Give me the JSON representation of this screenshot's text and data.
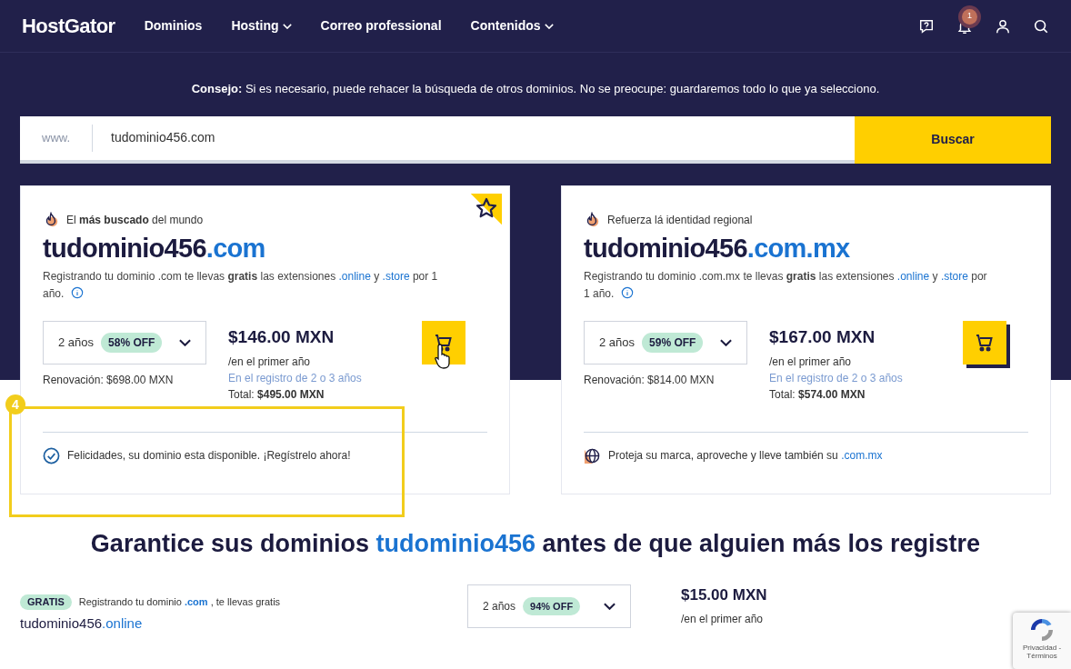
{
  "header": {
    "logo": "HostGator",
    "nav": [
      {
        "label": "Dominios",
        "has_menu": false
      },
      {
        "label": "Hosting",
        "has_menu": true
      },
      {
        "label": "Correo professional",
        "has_menu": false
      },
      {
        "label": "Contenidos",
        "has_menu": true
      }
    ],
    "notification_count": "1"
  },
  "tip": "**Consejo:** Si es necesario, puede rehacer la búsqueda de otros dominios. No se preocupe: guardaremos todo lo que ya selecciono.",
  "search": {
    "prefix": "www.",
    "value": "tudominio456.com",
    "button": "Buscar"
  },
  "cards": [
    {
      "featured": true,
      "tagline": "El **más buscado** del mundo",
      "name": "tudominio456",
      "tld": ".com",
      "description": [
        {
          "kind": "text",
          "text": "Registrando tu dominio .com te llevas "
        },
        {
          "kind": "bold",
          "text": "gratis"
        },
        {
          "kind": "text",
          "text": " las extensiones "
        },
        {
          "kind": "link",
          "text": ".online"
        },
        {
          "kind": "text",
          "text": " y "
        },
        {
          "kind": "link",
          "text": ".store"
        },
        {
          "kind": "text",
          "text": " por 1 año."
        }
      ],
      "term": "2 años",
      "discount": "58% OFF",
      "renewal": "Renovación: $698.00 MXN",
      "price": "$146.00 MXN",
      "period": "/en el primer año",
      "note": "En el registro de 2 o 3 años",
      "total_label": "Total:",
      "total": "$495.00 MXN",
      "hovered": true,
      "kind": "available",
      "footer": [
        {
          "kind": "text",
          "text": "Felicidades, su dominio esta disponible. ¡Regístrelo ahora!"
        }
      ]
    },
    {
      "featured": false,
      "tagline": "Refuerza lá identidad regional",
      "name": "tudominio456",
      "tld": ".com.mx",
      "description": [
        {
          "kind": "text",
          "text": "Registrando tu dominio .com.mx te llevas "
        },
        {
          "kind": "bold",
          "text": "gratis"
        },
        {
          "kind": "text",
          "text": " las extensiones "
        },
        {
          "kind": "link",
          "text": ".online"
        },
        {
          "kind": "text",
          "text": " y "
        },
        {
          "kind": "link",
          "text": ".store"
        },
        {
          "kind": "text",
          "text": " por 1 año."
        }
      ],
      "term": "2 años",
      "discount": "59% OFF",
      "renewal": "Renovación: $814.00 MXN",
      "price": "$167.00 MXN",
      "period": "/en el primer año",
      "note": "En el registro de 2 o 3 años",
      "total_label": "Total:",
      "total": "$574.00 MXN",
      "hovered": false,
      "kind": "protect",
      "footer": [
        {
          "kind": "text",
          "text": "Proteja su marca, aproveche y lleve también su "
        },
        {
          "kind": "link",
          "text": ".com.mx"
        }
      ]
    }
  ],
  "annotation": {
    "number": "4"
  },
  "heading": [
    {
      "kind": "text",
      "text": "Garantice sus dominios "
    },
    {
      "kind": "link",
      "text": "tudominio456"
    },
    {
      "kind": "text",
      "text": " antes de que alguien más los registre"
    }
  ],
  "offer": {
    "badge": "GRATIS",
    "text": [
      {
        "kind": "text",
        "text": "Registrando tu dominio "
      },
      {
        "kind": "bold_link",
        "text": ".com"
      },
      {
        "kind": "text",
        "text": " , te llevas gratis"
      }
    ],
    "name": "tudominio456",
    "tld": ".online",
    "term": "2 años",
    "discount": "94% OFF",
    "price": "$15.00 MXN",
    "period": "/en el primer año"
  },
  "recaptcha": {
    "links": "Privacidad - Términos"
  }
}
